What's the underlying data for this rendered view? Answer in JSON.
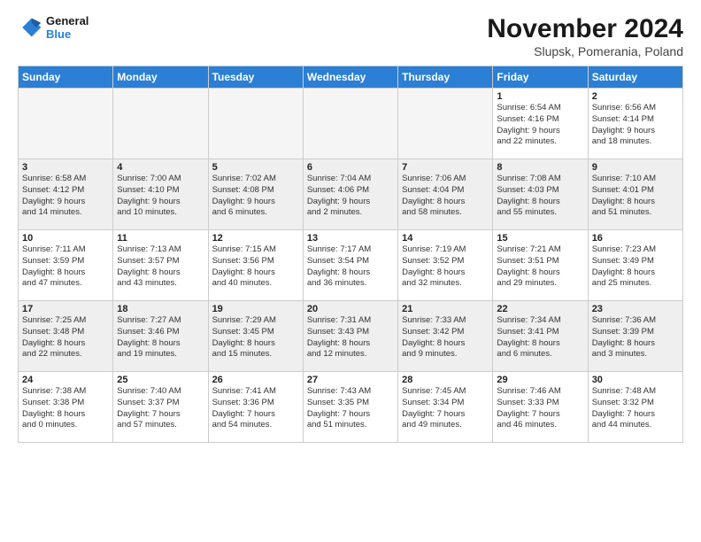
{
  "logo": {
    "line1": "General",
    "line2": "Blue"
  },
  "title": "November 2024",
  "subtitle": "Slupsk, Pomerania, Poland",
  "weekdays": [
    "Sunday",
    "Monday",
    "Tuesday",
    "Wednesday",
    "Thursday",
    "Friday",
    "Saturday"
  ],
  "weeks": [
    [
      {
        "day": "",
        "info": ""
      },
      {
        "day": "",
        "info": ""
      },
      {
        "day": "",
        "info": ""
      },
      {
        "day": "",
        "info": ""
      },
      {
        "day": "",
        "info": ""
      },
      {
        "day": "1",
        "info": "Sunrise: 6:54 AM\nSunset: 4:16 PM\nDaylight: 9 hours\nand 22 minutes."
      },
      {
        "day": "2",
        "info": "Sunrise: 6:56 AM\nSunset: 4:14 PM\nDaylight: 9 hours\nand 18 minutes."
      }
    ],
    [
      {
        "day": "3",
        "info": "Sunrise: 6:58 AM\nSunset: 4:12 PM\nDaylight: 9 hours\nand 14 minutes."
      },
      {
        "day": "4",
        "info": "Sunrise: 7:00 AM\nSunset: 4:10 PM\nDaylight: 9 hours\nand 10 minutes."
      },
      {
        "day": "5",
        "info": "Sunrise: 7:02 AM\nSunset: 4:08 PM\nDaylight: 9 hours\nand 6 minutes."
      },
      {
        "day": "6",
        "info": "Sunrise: 7:04 AM\nSunset: 4:06 PM\nDaylight: 9 hours\nand 2 minutes."
      },
      {
        "day": "7",
        "info": "Sunrise: 7:06 AM\nSunset: 4:04 PM\nDaylight: 8 hours\nand 58 minutes."
      },
      {
        "day": "8",
        "info": "Sunrise: 7:08 AM\nSunset: 4:03 PM\nDaylight: 8 hours\nand 55 minutes."
      },
      {
        "day": "9",
        "info": "Sunrise: 7:10 AM\nSunset: 4:01 PM\nDaylight: 8 hours\nand 51 minutes."
      }
    ],
    [
      {
        "day": "10",
        "info": "Sunrise: 7:11 AM\nSunset: 3:59 PM\nDaylight: 8 hours\nand 47 minutes."
      },
      {
        "day": "11",
        "info": "Sunrise: 7:13 AM\nSunset: 3:57 PM\nDaylight: 8 hours\nand 43 minutes."
      },
      {
        "day": "12",
        "info": "Sunrise: 7:15 AM\nSunset: 3:56 PM\nDaylight: 8 hours\nand 40 minutes."
      },
      {
        "day": "13",
        "info": "Sunrise: 7:17 AM\nSunset: 3:54 PM\nDaylight: 8 hours\nand 36 minutes."
      },
      {
        "day": "14",
        "info": "Sunrise: 7:19 AM\nSunset: 3:52 PM\nDaylight: 8 hours\nand 32 minutes."
      },
      {
        "day": "15",
        "info": "Sunrise: 7:21 AM\nSunset: 3:51 PM\nDaylight: 8 hours\nand 29 minutes."
      },
      {
        "day": "16",
        "info": "Sunrise: 7:23 AM\nSunset: 3:49 PM\nDaylight: 8 hours\nand 25 minutes."
      }
    ],
    [
      {
        "day": "17",
        "info": "Sunrise: 7:25 AM\nSunset: 3:48 PM\nDaylight: 8 hours\nand 22 minutes."
      },
      {
        "day": "18",
        "info": "Sunrise: 7:27 AM\nSunset: 3:46 PM\nDaylight: 8 hours\nand 19 minutes."
      },
      {
        "day": "19",
        "info": "Sunrise: 7:29 AM\nSunset: 3:45 PM\nDaylight: 8 hours\nand 15 minutes."
      },
      {
        "day": "20",
        "info": "Sunrise: 7:31 AM\nSunset: 3:43 PM\nDaylight: 8 hours\nand 12 minutes."
      },
      {
        "day": "21",
        "info": "Sunrise: 7:33 AM\nSunset: 3:42 PM\nDaylight: 8 hours\nand 9 minutes."
      },
      {
        "day": "22",
        "info": "Sunrise: 7:34 AM\nSunset: 3:41 PM\nDaylight: 8 hours\nand 6 minutes."
      },
      {
        "day": "23",
        "info": "Sunrise: 7:36 AM\nSunset: 3:39 PM\nDaylight: 8 hours\nand 3 minutes."
      }
    ],
    [
      {
        "day": "24",
        "info": "Sunrise: 7:38 AM\nSunset: 3:38 PM\nDaylight: 8 hours\nand 0 minutes."
      },
      {
        "day": "25",
        "info": "Sunrise: 7:40 AM\nSunset: 3:37 PM\nDaylight: 7 hours\nand 57 minutes."
      },
      {
        "day": "26",
        "info": "Sunrise: 7:41 AM\nSunset: 3:36 PM\nDaylight: 7 hours\nand 54 minutes."
      },
      {
        "day": "27",
        "info": "Sunrise: 7:43 AM\nSunset: 3:35 PM\nDaylight: 7 hours\nand 51 minutes."
      },
      {
        "day": "28",
        "info": "Sunrise: 7:45 AM\nSunset: 3:34 PM\nDaylight: 7 hours\nand 49 minutes."
      },
      {
        "day": "29",
        "info": "Sunrise: 7:46 AM\nSunset: 3:33 PM\nDaylight: 7 hours\nand 46 minutes."
      },
      {
        "day": "30",
        "info": "Sunrise: 7:48 AM\nSunset: 3:32 PM\nDaylight: 7 hours\nand 44 minutes."
      }
    ]
  ]
}
